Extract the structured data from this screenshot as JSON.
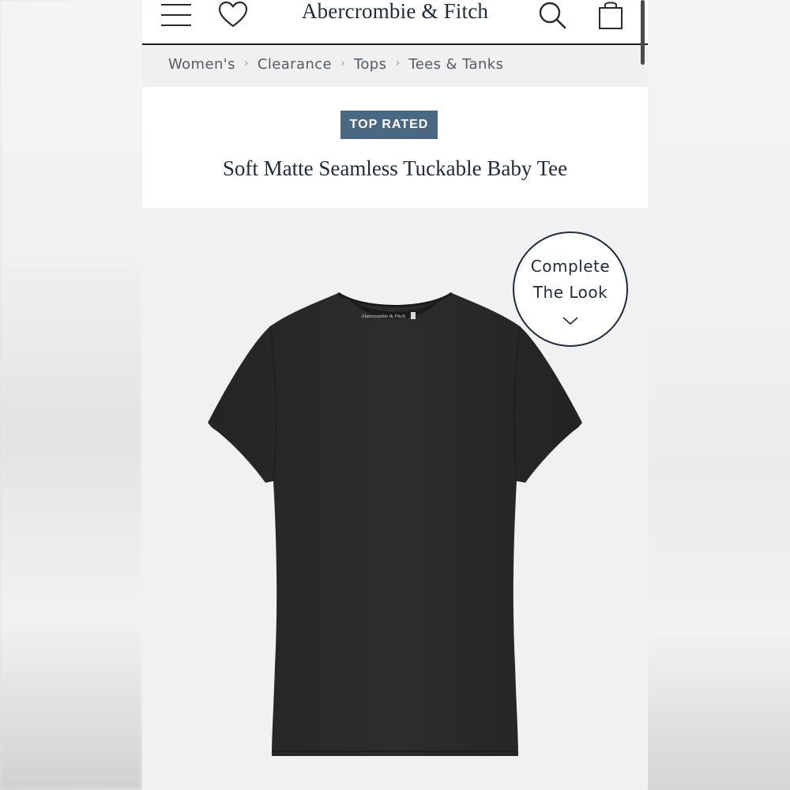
{
  "header": {
    "brand": "Abercrombie & Fitch",
    "icons": [
      "menu-icon",
      "heart-icon",
      "search-icon",
      "shopping-bag-icon"
    ]
  },
  "breadcrumb": [
    "Women's",
    "Clearance",
    "Tops",
    "Tees & Tanks"
  ],
  "product": {
    "badge": "TOP RATED",
    "title": "Soft Matte Seamless Tuckable Baby Tee",
    "label_text": "Abercrombie & Fitch",
    "color_hex": "#2a2b2b"
  },
  "complete_the_look": {
    "line1": "Complete",
    "line2": "The Look"
  },
  "colors": {
    "accent": "#4b6882",
    "text": "#1f2a3a",
    "breadcrumb": "#555b63"
  }
}
